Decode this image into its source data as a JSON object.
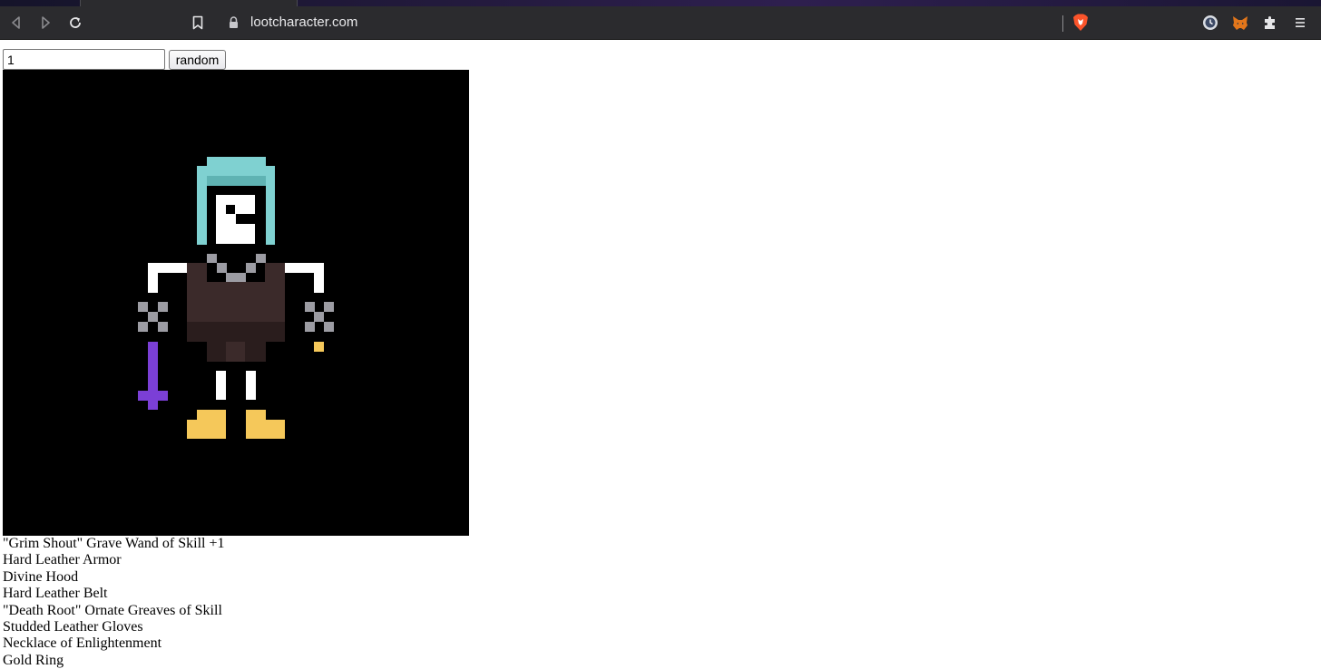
{
  "browser": {
    "url": "lootcharacter.com",
    "toolbar_icons": [
      "back-icon",
      "forward-icon",
      "reload-icon",
      "bookmark-icon",
      "lock-icon",
      "brave-shields-icon",
      "extension-clock-icon",
      "metamask-icon",
      "extensions-puzzle-icon",
      "menu-icon"
    ],
    "brave_color": "#fb542b",
    "metamask_color": "#e2761b"
  },
  "page": {
    "token_input": {
      "value": "1"
    },
    "random_button": {
      "label": "random"
    },
    "character": {
      "background": "#000000",
      "colors": {
        "hood": "#7fd1d1",
        "hood_shade": "#5fb3b3",
        "face": "#ffffff",
        "necklace": "#9c9ca3",
        "armor": "#3b2a2a",
        "armor_dark": "#2a1d1d",
        "wand": "#7b3fd6",
        "gold": "#f5c85a"
      }
    },
    "items": [
      "\"Grim Shout\" Grave Wand of Skill +1",
      "Hard Leather Armor",
      "Divine Hood",
      "Hard Leather Belt",
      "\"Death Root\" Ornate Greaves of Skill",
      "Studded Leather Gloves",
      "Necklace of Enlightenment",
      "Gold Ring"
    ]
  }
}
